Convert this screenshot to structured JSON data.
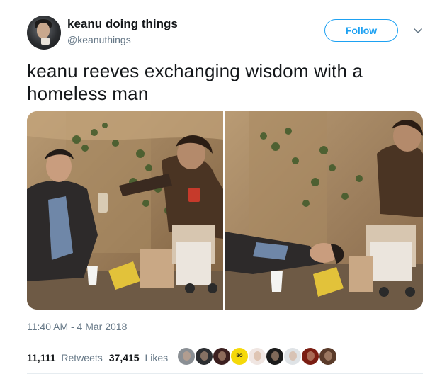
{
  "tweet": {
    "display_name": "keanu doing things",
    "handle": "@keanuthings",
    "follow_label": "Follow",
    "text_line1": "keanu reeves exchanging wisdom with a",
    "text_line2": "homeless man",
    "timestamp": "11:40 AM - 4 Mar 2018",
    "retweets": {
      "count": "11,111",
      "label": "Retweets"
    },
    "likes": {
      "count": "37,415",
      "label": "Likes"
    },
    "liker_avatars": [
      {
        "name": "liker-avatar-1",
        "color": "#8a8f94"
      },
      {
        "name": "liker-avatar-2",
        "color": "#2c2e31"
      },
      {
        "name": "liker-avatar-3",
        "color": "#3b1f1f"
      },
      {
        "name": "liker-avatar-4",
        "color": "#f5d90a",
        "text": "BO"
      },
      {
        "name": "liker-avatar-5",
        "color": "#f0e6e2"
      },
      {
        "name": "liker-avatar-6",
        "color": "#1b1b1b"
      },
      {
        "name": "liker-avatar-7",
        "color": "#dfe3e6"
      },
      {
        "name": "liker-avatar-8",
        "color": "#7a1d12"
      },
      {
        "name": "liker-avatar-9",
        "color": "#5a3b2a"
      }
    ]
  },
  "colors": {
    "accent": "#1da1f2",
    "secondary_text": "#657786",
    "primary_text": "#14171a",
    "divider": "#e6ecf0"
  },
  "icons": {
    "caret": "chevron-down-icon"
  }
}
